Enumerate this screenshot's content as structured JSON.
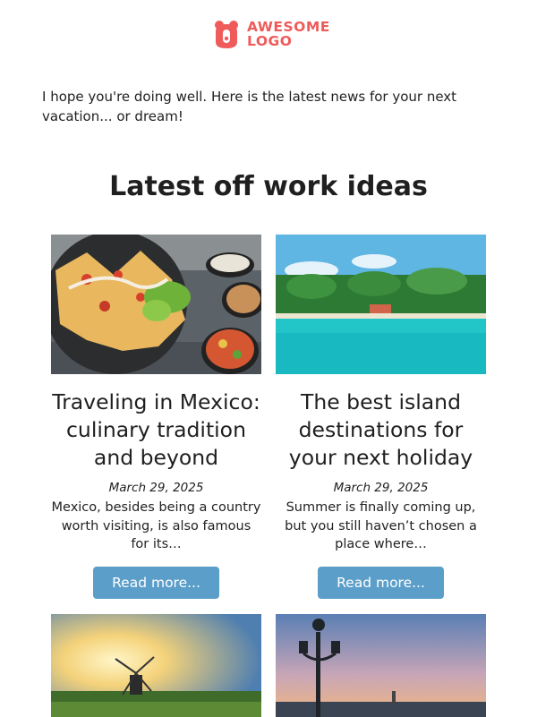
{
  "brand": {
    "logo_line1": "AWESOME",
    "logo_line2": "LOGO",
    "color": "#ef5b5b",
    "icon": "bear-head-icon"
  },
  "intro_text": "I hope you're doing well. Here is the latest news for your next vacation... or dream!",
  "section_title": "Latest off work ideas",
  "button_color": "#5b9ec9",
  "articles": [
    {
      "title": "Traveling in Mexico: culinary tradition and beyond",
      "date": "March 29, 2025",
      "excerpt": "Mexico, besides being a country worth visiting, is also famous for its…",
      "button": "Read more...",
      "image": "nachos-plate-image"
    },
    {
      "title": "The best island destinations for your next holiday",
      "date": "March 29, 2025",
      "excerpt": "Summer is finally coming up, but you still haven’t chosen a place where…",
      "button": "Read more...",
      "image": "tropical-island-image"
    },
    {
      "image": "windmill-sunset-image"
    },
    {
      "image": "venice-lamppost-image"
    }
  ]
}
